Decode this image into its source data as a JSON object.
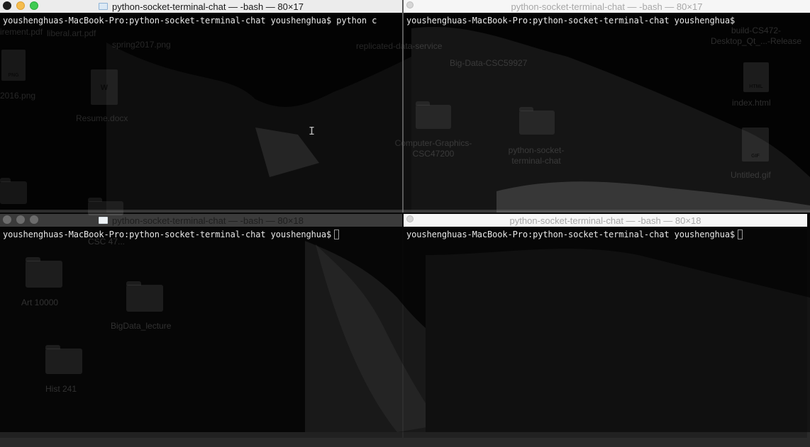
{
  "desktop": {
    "icons": [
      {
        "label": "irement.pdf",
        "kind": "file"
      },
      {
        "label": "liberal.art.pdf",
        "kind": "file"
      },
      {
        "label": "spring2017.png",
        "kind": "file"
      },
      {
        "label": "replicated-data-service",
        "kind": "folder"
      },
      {
        "label": "2016.png",
        "kind": "file",
        "badge": "PNG"
      },
      {
        "label": "Resume.docx",
        "kind": "file",
        "badge": "W"
      },
      {
        "label": "Big-Data-CSC59927",
        "kind": "folder"
      },
      {
        "label": "build-CS472-Desktop_Qt_...-Release",
        "kind": "folder"
      },
      {
        "label": "index.html",
        "kind": "file",
        "badge": "HTML"
      },
      {
        "label": "Computer-Graphics-CSC47200",
        "kind": "folder"
      },
      {
        "label": "python-socket-terminal-chat",
        "kind": "folder"
      },
      {
        "label": "Untitled.gif",
        "kind": "file",
        "badge": "GIF"
      },
      {
        "label": "CSC 47...",
        "kind": "folder"
      },
      {
        "label": "Art 10000",
        "kind": "folder"
      },
      {
        "label": "BigData_lecture",
        "kind": "folder"
      },
      {
        "label": "Hist 241",
        "kind": "folder"
      }
    ]
  },
  "terminals": [
    {
      "title": "python-socket-terminal-chat — -bash — 80×17",
      "state": "active",
      "prompt": "youshenghuas-MacBook-Pro:python-socket-terminal-chat youshenghua$",
      "input": " python c"
    },
    {
      "title": "python-socket-terminal-chat — -bash — 80×17",
      "state": "inactive",
      "prompt": "youshenghuas-MacBook-Pro:python-socket-terminal-chat youshenghua$",
      "input": ""
    },
    {
      "title": "python-socket-terminal-chat — -bash — 80×18",
      "state": "dim",
      "prompt": "youshenghuas-MacBook-Pro:python-socket-terminal-chat youshenghua$",
      "input": ""
    },
    {
      "title": "python-socket-terminal-chat — -bash — 80×18",
      "state": "inactive",
      "prompt": "youshenghuas-MacBook-Pro:python-socket-terminal-chat youshenghua$",
      "input": ""
    }
  ],
  "colors": {
    "close": "#1d1d1d",
    "minimize": "#f5bd4f",
    "maximize": "#3fcb52",
    "terminal_text": "#e8e8e8"
  }
}
